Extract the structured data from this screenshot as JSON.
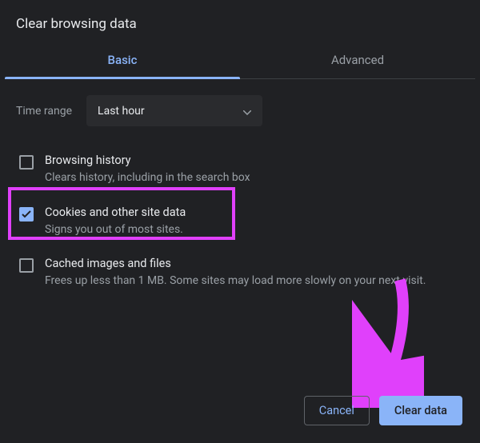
{
  "dialog": {
    "title": "Clear browsing data"
  },
  "tabs": {
    "basic": "Basic",
    "advanced": "Advanced",
    "active": "basic"
  },
  "time_range": {
    "label": "Time range",
    "selected": "Last hour"
  },
  "options": [
    {
      "key": "browsing-history",
      "title": "Browsing history",
      "description": "Clears history, including in the search box",
      "checked": false
    },
    {
      "key": "cookies",
      "title": "Cookies and other site data",
      "description": "Signs you out of most sites.",
      "checked": true
    },
    {
      "key": "cached",
      "title": "Cached images and files",
      "description": "Frees up less than 1 MB. Some sites may load more slowly on your next visit.",
      "checked": false
    }
  ],
  "actions": {
    "cancel": "Cancel",
    "clear": "Clear data"
  },
  "annotations": {
    "highlight_option_index": 1,
    "arrow_color": "#e040fb"
  }
}
